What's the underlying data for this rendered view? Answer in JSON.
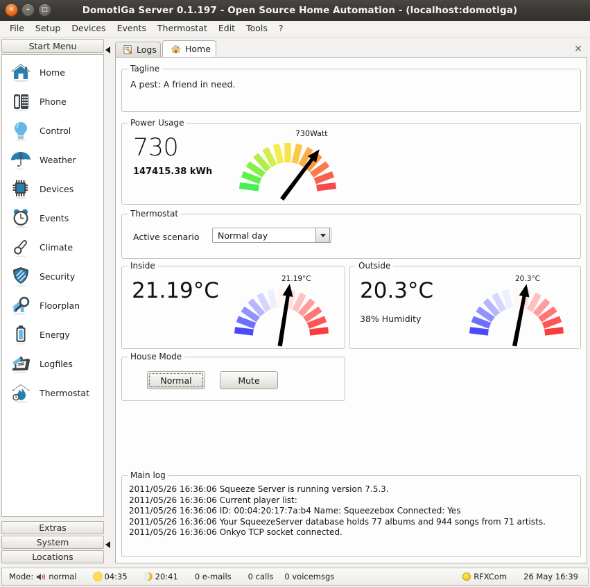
{
  "window": {
    "title": "DomotiGa Server 0.1.197 - Open Source Home Automation - (localhost:domotiga)",
    "close_glyph": "✕",
    "minimize_glyph": "–",
    "maximize_glyph": "□"
  },
  "menubar": {
    "items": [
      "File",
      "Setup",
      "Devices",
      "Events",
      "Thermostat",
      "Edit",
      "Tools",
      "?"
    ]
  },
  "sidebar": {
    "header": "Start Menu",
    "items": [
      {
        "label": "Home",
        "icon": "house-icon"
      },
      {
        "label": "Phone",
        "icon": "phone-icon"
      },
      {
        "label": "Control",
        "icon": "lightbulb-icon"
      },
      {
        "label": "Weather",
        "icon": "umbrella-icon"
      },
      {
        "label": "Devices",
        "icon": "chip-icon"
      },
      {
        "label": "Events",
        "icon": "alarm-clock-icon"
      },
      {
        "label": "Climate",
        "icon": "thermometer-icon"
      },
      {
        "label": "Security",
        "icon": "shield-icon"
      },
      {
        "label": "Floorplan",
        "icon": "house-magnifier-icon"
      },
      {
        "label": "Energy",
        "icon": "battery-icon"
      },
      {
        "label": "Logfiles",
        "icon": "scroll-pencil-icon"
      },
      {
        "label": "Thermostat",
        "icon": "flame-clock-icon"
      }
    ],
    "footer_buttons": [
      "Extras",
      "System",
      "Locations"
    ]
  },
  "tabs": [
    {
      "label": "Logs",
      "icon": "notepad-pencil-icon",
      "active": false
    },
    {
      "label": "Home",
      "icon": "house-icon",
      "active": true
    }
  ],
  "tab_close_glyph": "✕",
  "tagline": {
    "legend": "Tagline",
    "text": "A pest: A friend in need."
  },
  "power": {
    "legend": "Power Usage",
    "value": "730",
    "total": "147415.38 kWh",
    "gauge_label": "730Watt",
    "gauge": {
      "segments": 13,
      "needle_angle_deg": 62,
      "colors": [
        "#46ef52",
        "#5ef14c",
        "#86f04a",
        "#aeef49",
        "#d2ee4a",
        "#f2ed4c",
        "#fbe048",
        "#fbc846",
        "#fbae46",
        "#fb9447",
        "#fb7a49",
        "#fa604b",
        "#f9494d"
      ]
    }
  },
  "thermostat": {
    "legend": "Thermostat",
    "label": "Active scenario",
    "selected": "Normal day",
    "options": [
      "Normal day"
    ]
  },
  "inside": {
    "legend": "Inside",
    "value": "21.19°C",
    "gauge_label": "21.19°C",
    "needle_angle_deg": 83
  },
  "outside": {
    "legend": "Outside",
    "value": "20.3°C",
    "humidity": "38% Humidity",
    "gauge_label": "20.3°C",
    "needle_angle_deg": 81
  },
  "house_mode": {
    "legend": "House Mode",
    "buttons": [
      {
        "label": "Normal",
        "focused": true
      },
      {
        "label": "Mute",
        "focused": false
      }
    ]
  },
  "main_log": {
    "legend": "Main log",
    "lines": [
      "2011/05/26 16:36:06 Squeeze Server is running version 7.5.3.",
      "2011/05/26 16:36:06 Current player list:",
      "2011/05/26 16:36:06 ID: 00:04:20:17:7a:b4 Name: Squeezebox Connected: Yes",
      "2011/05/26 16:36:06 Your SqueezeServer database holds 77 albums and 944 songs from 71 artists.",
      "2011/05/26 16:36:06 Onkyo TCP socket connected."
    ]
  },
  "statusbar": {
    "mode_label": "Mode:",
    "mode_value": "normal",
    "sunrise": "04:35",
    "sunset": "20:41",
    "emails": "0 e-mails",
    "calls": "0 calls",
    "voicemsgs": "0 voicemsgs",
    "device": "RFXCom",
    "datetime": "26 May 16:39"
  },
  "colors": {
    "title_bar": "#3c3935",
    "close_button": "#e2600f",
    "accent_blue": "#2e7fb8",
    "gauge_needle": "#000000"
  }
}
